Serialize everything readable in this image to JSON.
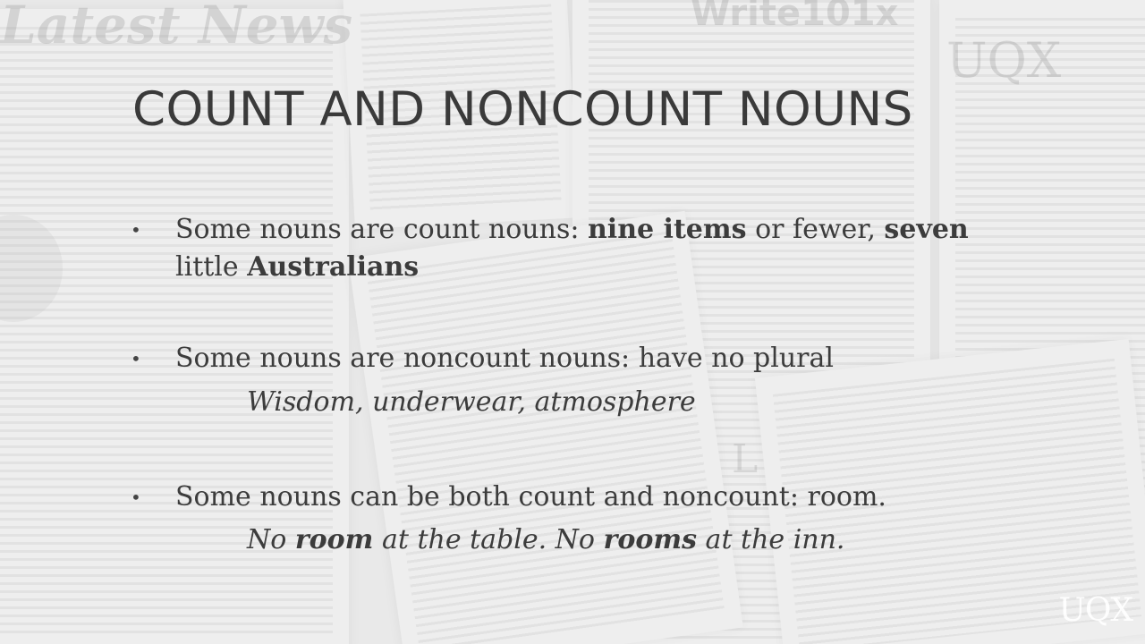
{
  "background": {
    "masthead_left": "Latest News",
    "masthead_center": "Write101x",
    "masthead_right": "UQX",
    "dropcap": "L"
  },
  "slide": {
    "title": "COUNT AND NONCOUNT NOUNS",
    "bullet_1": {
      "a": "Some nouns are count nouns: ",
      "b": "nine items",
      "c": " or fewer, ",
      "d": "seven",
      "e": "little ",
      "f": "Australians"
    },
    "bullet_2": {
      "text": "Some nouns are noncount nouns: have no plural",
      "example": "Wisdom, underwear, atmosphere"
    },
    "bullet_3": {
      "text": "Some nouns can be both count and noncount: room.",
      "ex_a": "No ",
      "ex_b": "room",
      "ex_c": " at the table. No ",
      "ex_d": "rooms",
      "ex_e": " at the inn."
    },
    "bullet_symbol": "•"
  },
  "logo": "UQX"
}
